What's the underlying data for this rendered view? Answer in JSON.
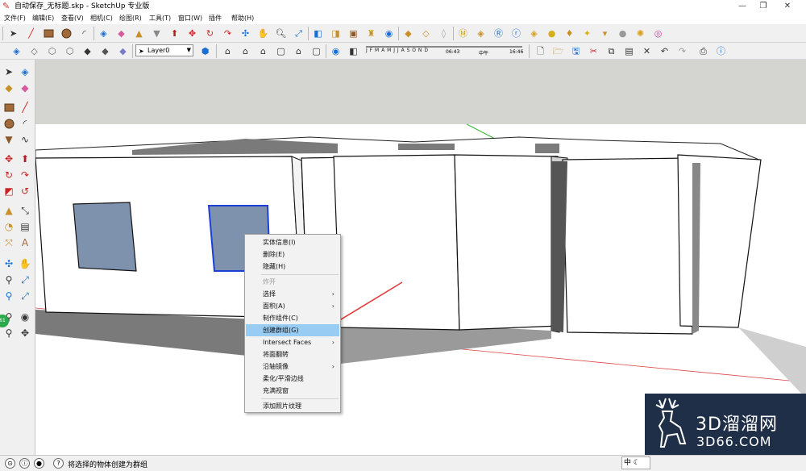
{
  "window": {
    "title": "自动保存_无标题.skp - SketchUp 专业版",
    "controls": [
      "—",
      "❐",
      "✕"
    ]
  },
  "menubar": {
    "items": [
      "文件(F)",
      "编辑(E)",
      "查看(V)",
      "相机(C)",
      "绘图(R)",
      "工具(T)",
      "窗口(W)",
      "插件",
      "帮助(H)"
    ]
  },
  "toolbar": {
    "layer_name": "Layer0",
    "shadow_months": "J F M A M J J A S O N D",
    "shadow_time_start": "06:43",
    "shadow_time_mid": "中午",
    "shadow_time_end": "16:46"
  },
  "left_toolbar": {
    "badge": "61"
  },
  "context_menu": {
    "items": [
      {
        "label": "实体信息(I)",
        "disabled": false,
        "submenu": false
      },
      {
        "label": "删除(E)",
        "disabled": false,
        "submenu": false
      },
      {
        "label": "隐藏(H)",
        "disabled": false,
        "submenu": false
      },
      {
        "label": "炸开",
        "disabled": true,
        "submenu": false
      },
      {
        "label": "选择",
        "disabled": false,
        "submenu": true
      },
      {
        "label": "面积(A)",
        "disabled": false,
        "submenu": true
      },
      {
        "label": "制作组件(C)",
        "disabled": false,
        "submenu": false
      },
      {
        "label": "创建群组(G)",
        "disabled": false,
        "submenu": false,
        "highlighted": true
      },
      {
        "label": "Intersect Faces",
        "disabled": false,
        "submenu": true
      },
      {
        "label": "将面翻转",
        "disabled": false,
        "submenu": false
      },
      {
        "label": "沿轴镜像",
        "disabled": false,
        "submenu": true
      },
      {
        "label": "柔化/平滑边线",
        "disabled": false,
        "submenu": false
      },
      {
        "label": "充满视窗",
        "disabled": false,
        "submenu": false
      },
      {
        "label": "添加照片纹理",
        "disabled": false,
        "submenu": false
      }
    ],
    "highlight_color": "#99ccf3"
  },
  "statusbar": {
    "text": "将选择的物体创建为群组",
    "ime": "中"
  },
  "watermark": {
    "brand": "3D溜溜网",
    "url": "3D66.COM",
    "background": "#1f2f48"
  },
  "colors": {
    "sky": "#d4d4d0",
    "ground": "#7a7a7a",
    "selection_blue": "#1e3fd6",
    "window_face": "#7f92ad",
    "arrow_red": "#e23a3a"
  }
}
